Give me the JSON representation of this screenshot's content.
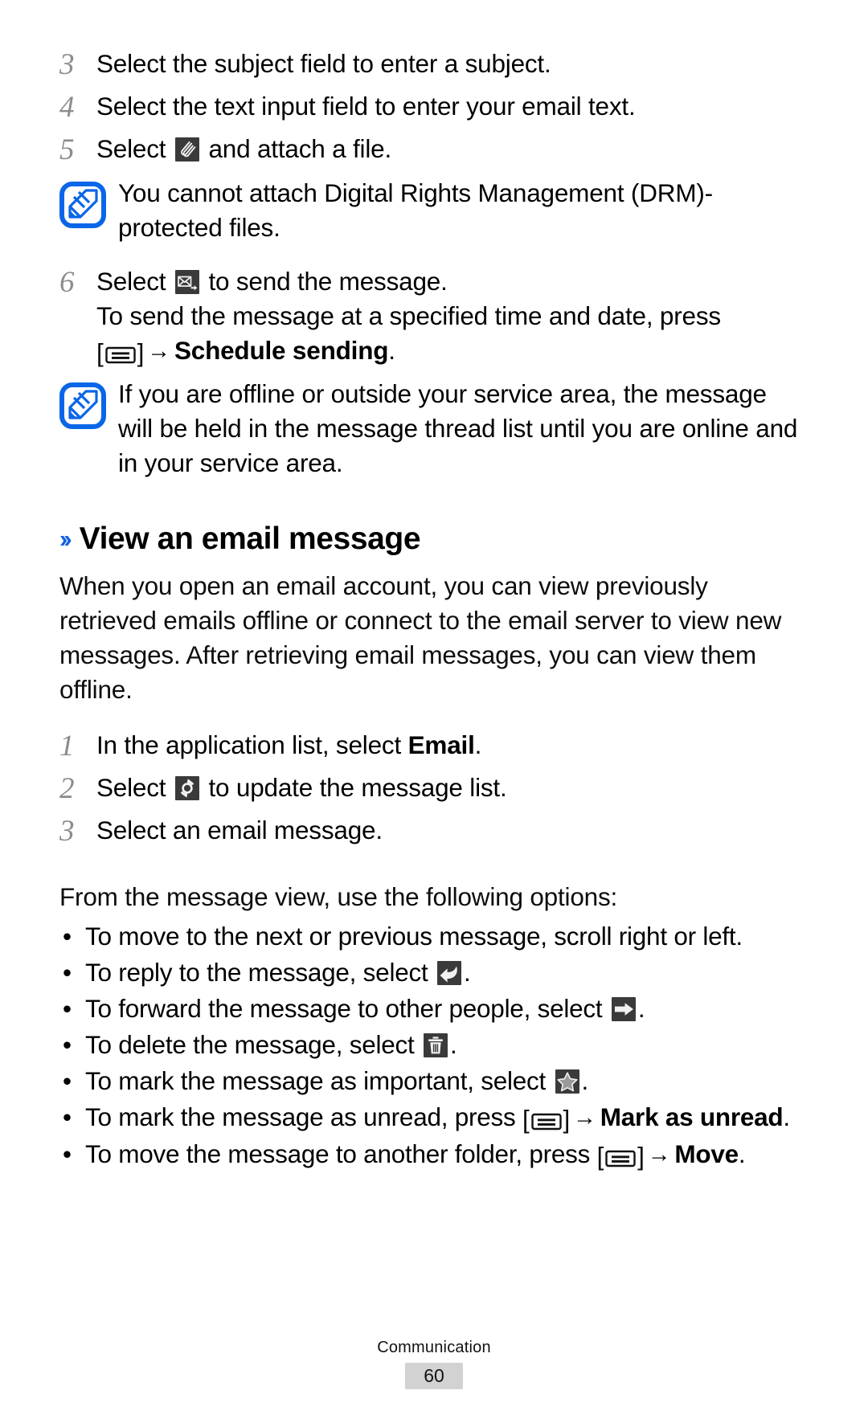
{
  "document": {
    "footer_section": "Communication",
    "page_number": "60",
    "accent_color": "#1060df",
    "icon_chip_color": "#3a3a3a"
  },
  "steps_compose": [
    {
      "num": "3",
      "text": "Select the subject field to enter a subject."
    },
    {
      "num": "4",
      "text": "Select the text input field to enter your email text."
    },
    {
      "num": "5",
      "text_before": "Select ",
      "icon": "paperclip-attach-icon",
      "text_after": " and attach a file."
    }
  ],
  "note_drm": {
    "icon": "note-pencil-icon",
    "text": "You cannot attach Digital Rights Management (DRM)-protected files."
  },
  "step_send": {
    "num": "6",
    "text_before": "Select ",
    "icon": "send-envelope-icon",
    "text_after": " to send the message.",
    "sub_line1": "To send the message at a specified time and date, press",
    "menu_key": "menu-key-icon",
    "arrow": "→",
    "bold_target": "Schedule sending",
    "period": "."
  },
  "note_offline": {
    "icon": "note-pencil-icon",
    "text": "If you are offline or outside your service area, the message will be held in the message thread list until you are online and in your service area."
  },
  "section": {
    "chevrons": "››",
    "title": "View an email message",
    "intro": "When you open an email account, you can view previously retrieved emails offline or connect to the email server to view new messages. After retrieving email messages, you can view them offline."
  },
  "steps_view": [
    {
      "num": "1",
      "text_before": "In the application list, select ",
      "bold": "Email",
      "text_after": "."
    },
    {
      "num": "2",
      "text_before": "Select ",
      "icon": "refresh-sync-icon",
      "text_after": " to update the message list."
    },
    {
      "num": "3",
      "text": "Select an email message."
    }
  ],
  "options": {
    "lead_in": "From the message view, use the following options:",
    "bullet_char": "•",
    "items": [
      {
        "text": "To move to the next or previous message, scroll right or left."
      },
      {
        "text_before": "To reply to the message, select ",
        "icon": "reply-arrow-icon",
        "text_after": "."
      },
      {
        "text_before": "To forward the message to other people, select ",
        "icon": "forward-arrow-icon",
        "text_after": "."
      },
      {
        "text_before": "To delete the message, select ",
        "icon": "trash-delete-icon",
        "text_after": "."
      },
      {
        "text_before": "To mark the message as important, select ",
        "icon": "star-important-icon",
        "text_after": "."
      },
      {
        "text_before": "To mark the message as unread, press ",
        "menu_key": "menu-key-icon",
        "arrow": "→",
        "bold": "Mark as unread",
        "text_after": "."
      },
      {
        "text_before": "To move the message to another folder, press ",
        "menu_key": "menu-key-icon",
        "arrow": "→",
        "bold": "Move",
        "text_after": "."
      }
    ]
  }
}
